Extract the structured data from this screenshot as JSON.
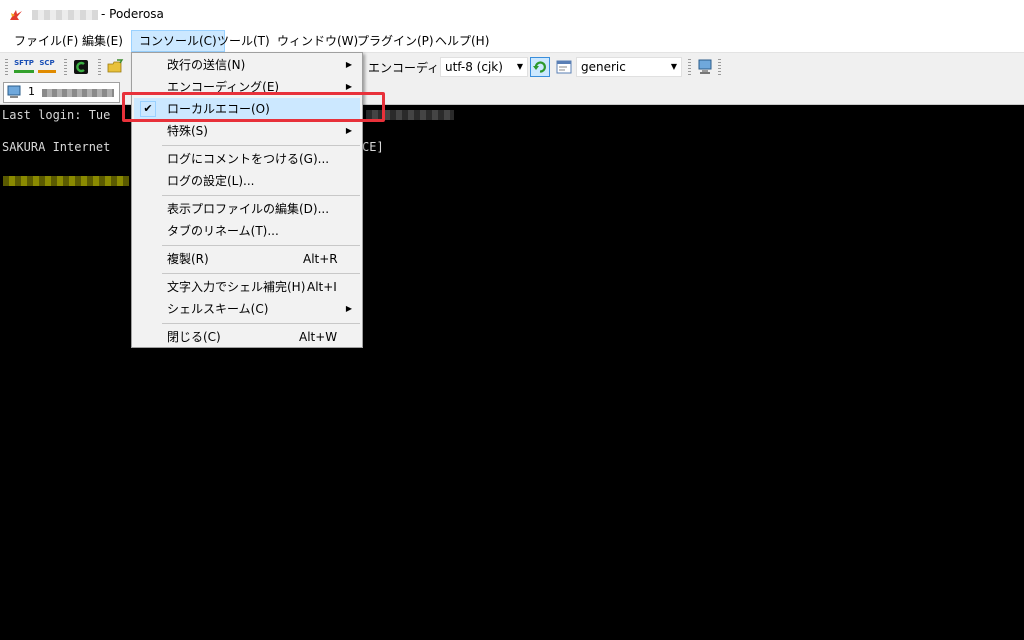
{
  "window": {
    "title": "- Poderosa",
    "app_icon": "poderosa-logo-icon"
  },
  "menubar": {
    "items": [
      "ファイル(F)",
      "編集(E)",
      "コンソール(C)",
      "ツール(T)",
      "ウィンドウ(W)",
      "プラグイン(P)",
      "ヘルプ(H)"
    ]
  },
  "toolbar": {
    "sftp_label": "SFTP",
    "scp_label": "SCP",
    "encoding_label": "エンコーディング",
    "encoding_value": "utf-8 (cjk)",
    "terminal_type_value": "generic"
  },
  "tabs": [
    {
      "label": "1"
    }
  ],
  "terminal": {
    "lines": [
      "Last login: Tue",
      "SAKURA Internet",
      "CE]"
    ]
  },
  "console_menu": {
    "items": [
      {
        "label": "改行の送信(N)",
        "submenu": true
      },
      {
        "label": "エンコーディング(E)",
        "submenu": true
      },
      {
        "label": "ローカルエコー(O)",
        "checked": true
      },
      {
        "label": "特殊(S)",
        "submenu": true
      },
      {
        "label": "ログにコメントをつける(G)..."
      },
      {
        "label": "ログの設定(L)..."
      },
      {
        "label": "表示プロファイルの編集(D)..."
      },
      {
        "label": "タブのリネーム(T)..."
      },
      {
        "label": "複製(R)",
        "shortcut": "Alt+R"
      },
      {
        "label": "文字入力でシェル補完(H)",
        "shortcut": "Alt+I"
      },
      {
        "label": "シェルスキーム(C)",
        "submenu": true
      },
      {
        "label": "閉じる(C)",
        "shortcut": "Alt+W"
      }
    ]
  },
  "colors": {
    "highlight": "#e8313a",
    "menu_hover": "#cce8ff",
    "terminal_bg": "#000000"
  }
}
